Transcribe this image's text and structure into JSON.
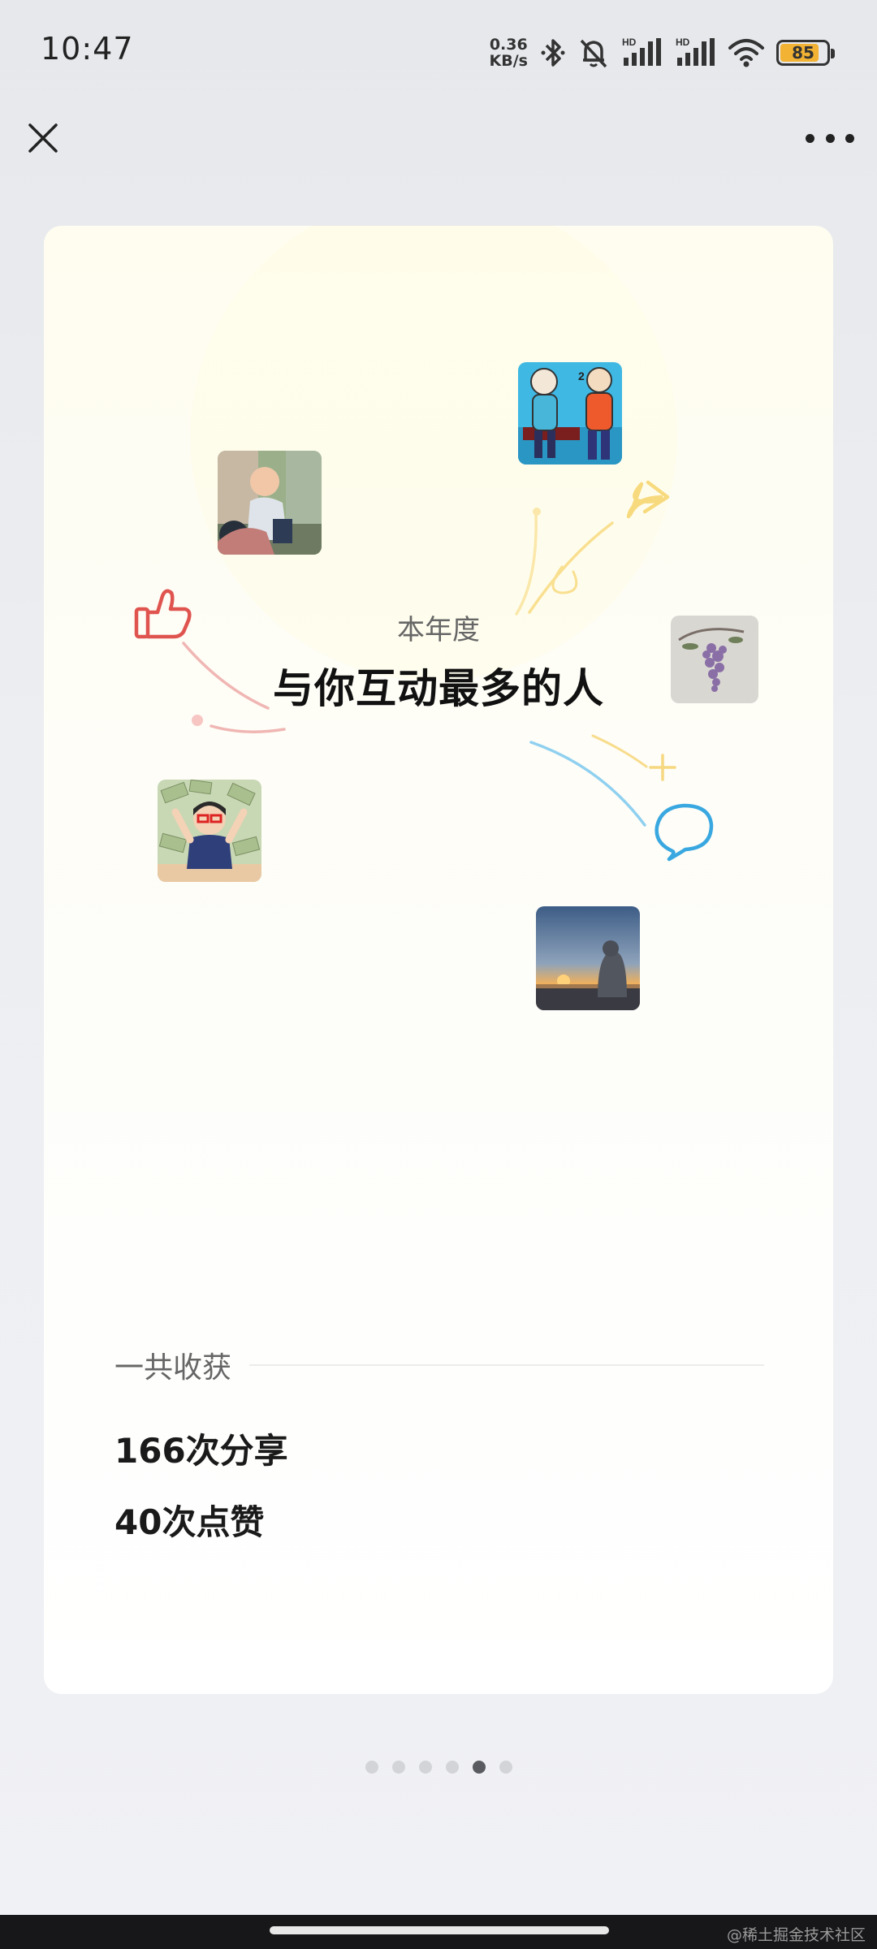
{
  "status_bar": {
    "time": "10:47",
    "speed_value": "0.36",
    "speed_unit": "KB/s",
    "signal_1_label": "HD",
    "signal_2_label": "HD",
    "battery": "85",
    "battery_level": 0.85,
    "battery_color": "#f2b233"
  },
  "top_bar": {
    "close_icon": "close-icon",
    "more_icon": "more-dots-icon"
  },
  "card": {
    "subtitle": "本年度",
    "title": "与你互动最多的人",
    "harvest_label": "一共收获",
    "stats": [
      "166次分享",
      "40次点赞"
    ],
    "decor_icons": [
      "thumbs-up-icon",
      "share-arrow-icon",
      "comment-bubble-icon"
    ]
  },
  "pager": {
    "count": 6,
    "active_index": 4
  },
  "footer": {
    "watermark": "@稀土掘金技术社区"
  },
  "colors": {
    "like": "#e0544f",
    "share": "#f4c84a",
    "comment": "#3aa8e0"
  }
}
